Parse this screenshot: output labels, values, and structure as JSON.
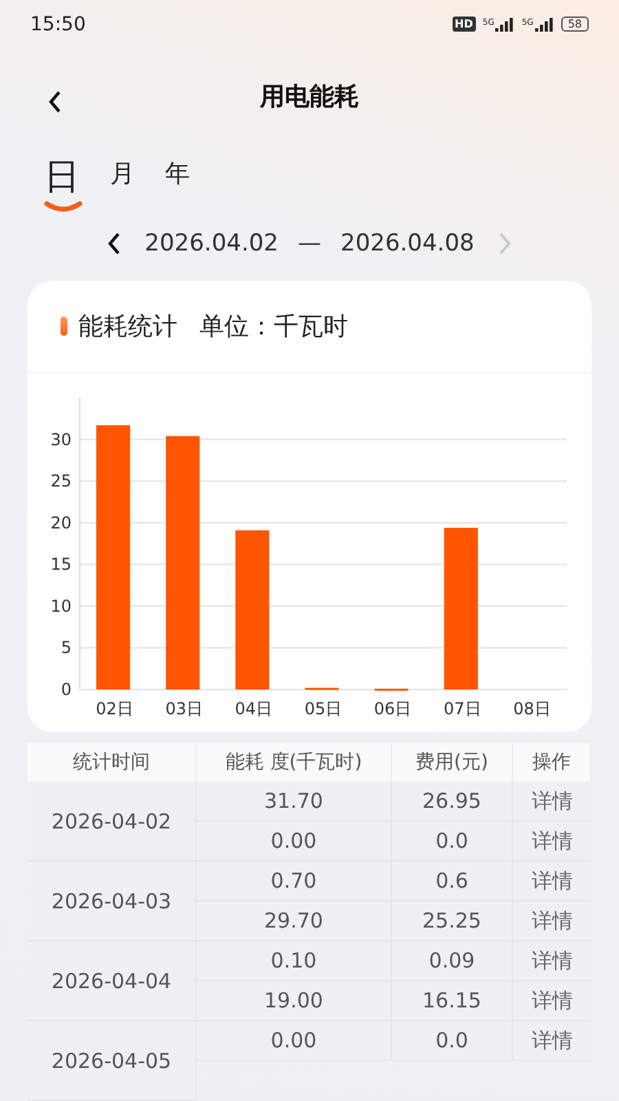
{
  "status_bar": {
    "time": "15:50",
    "hd": "HD",
    "networks": [
      "5G",
      "5G"
    ],
    "battery": "58"
  },
  "header": {
    "title": "用电能耗"
  },
  "tabs": [
    {
      "label": "日",
      "selected": true
    },
    {
      "label": "月",
      "selected": false
    },
    {
      "label": "年",
      "selected": false
    }
  ],
  "date_range": {
    "start": "2026.04.02",
    "separator": "—",
    "end": "2026.04.08",
    "next_disabled": true
  },
  "chart_card": {
    "title": "能耗统计",
    "unit": "单位：千瓦时",
    "chart_data": {
      "type": "bar",
      "categories": [
        "02日",
        "03日",
        "04日",
        "05日",
        "06日",
        "07日",
        "08日"
      ],
      "series": [
        {
          "color": "#ff5500",
          "values": [
            31.7,
            30.4,
            19.1,
            0.2,
            0.1,
            19.4,
            0
          ]
        }
      ],
      "grid": true,
      "ylim": [
        0,
        35
      ],
      "yticks": [
        0,
        5,
        10,
        15,
        20,
        25,
        30
      ]
    }
  },
  "table": {
    "columns": [
      "统计时间",
      "能耗 度(千瓦时)",
      "费用(元)",
      "操作"
    ],
    "groups": [
      {
        "date": "2026-04-02",
        "rows": [
          {
            "energy": "31.70",
            "cost": "26.95",
            "action": "详情"
          },
          {
            "energy": "0.00",
            "cost": "0.0",
            "action": "详情"
          }
        ]
      },
      {
        "date": "2026-04-03",
        "rows": [
          {
            "energy": "0.70",
            "cost": "0.6",
            "action": "详情"
          },
          {
            "energy": "29.70",
            "cost": "25.25",
            "action": "详情"
          }
        ]
      },
      {
        "date": "2026-04-04",
        "rows": [
          {
            "energy": "0.10",
            "cost": "0.09",
            "action": "详情"
          },
          {
            "energy": "19.00",
            "cost": "16.15",
            "action": "详情"
          }
        ]
      },
      {
        "date": "2026-04-05",
        "rows": [
          {
            "energy": "0.00",
            "cost": "0.0",
            "action": "详情"
          }
        ]
      }
    ]
  }
}
